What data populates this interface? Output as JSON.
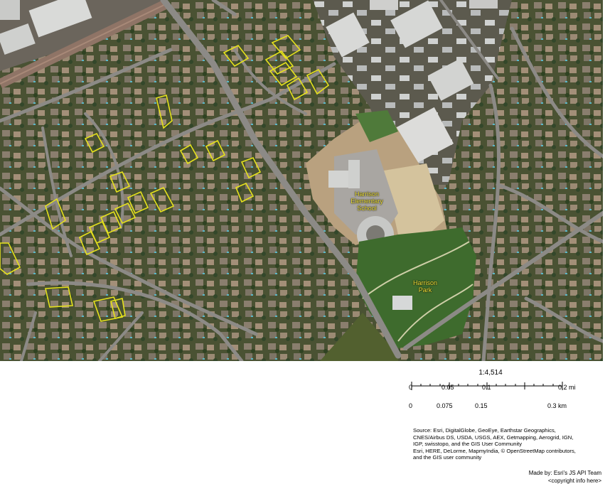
{
  "map": {
    "labels": {
      "school": [
        "Harrison",
        "Elementary",
        "School"
      ],
      "park": [
        "Harrison",
        "Park"
      ]
    },
    "colors": {
      "parcel_outline": "#e6e21c",
      "label_text": "#f2e33a",
      "vegetation": "#3f5a2c",
      "roofs": "#8a7a6a",
      "roads": "#8c8a86"
    }
  },
  "scale": {
    "ratio": "1:4,514",
    "top_ticks": [
      "0",
      "0.05",
      "0.1",
      "0.2 mi"
    ],
    "bottom_ticks": [
      "0",
      "0.075",
      "0.15",
      "0.3 km"
    ]
  },
  "attribution": {
    "source_lines": [
      "Source: Esri, DigitalGlobe, GeoEye, Earthstar Geographics,",
      "CNES/Airbus DS, USDA, USGS, AEX, Getmapping, Aerogrid, IGN,",
      "IGP, swisstopo, and the GIS User Community",
      "Esri, HERE, DeLorme, MapmyIndia, © OpenStreetMap contributors,",
      "and the GIS user community"
    ],
    "made_by": "Made by:  Esri's JS API Team",
    "copyright": "<copyright info here>"
  }
}
